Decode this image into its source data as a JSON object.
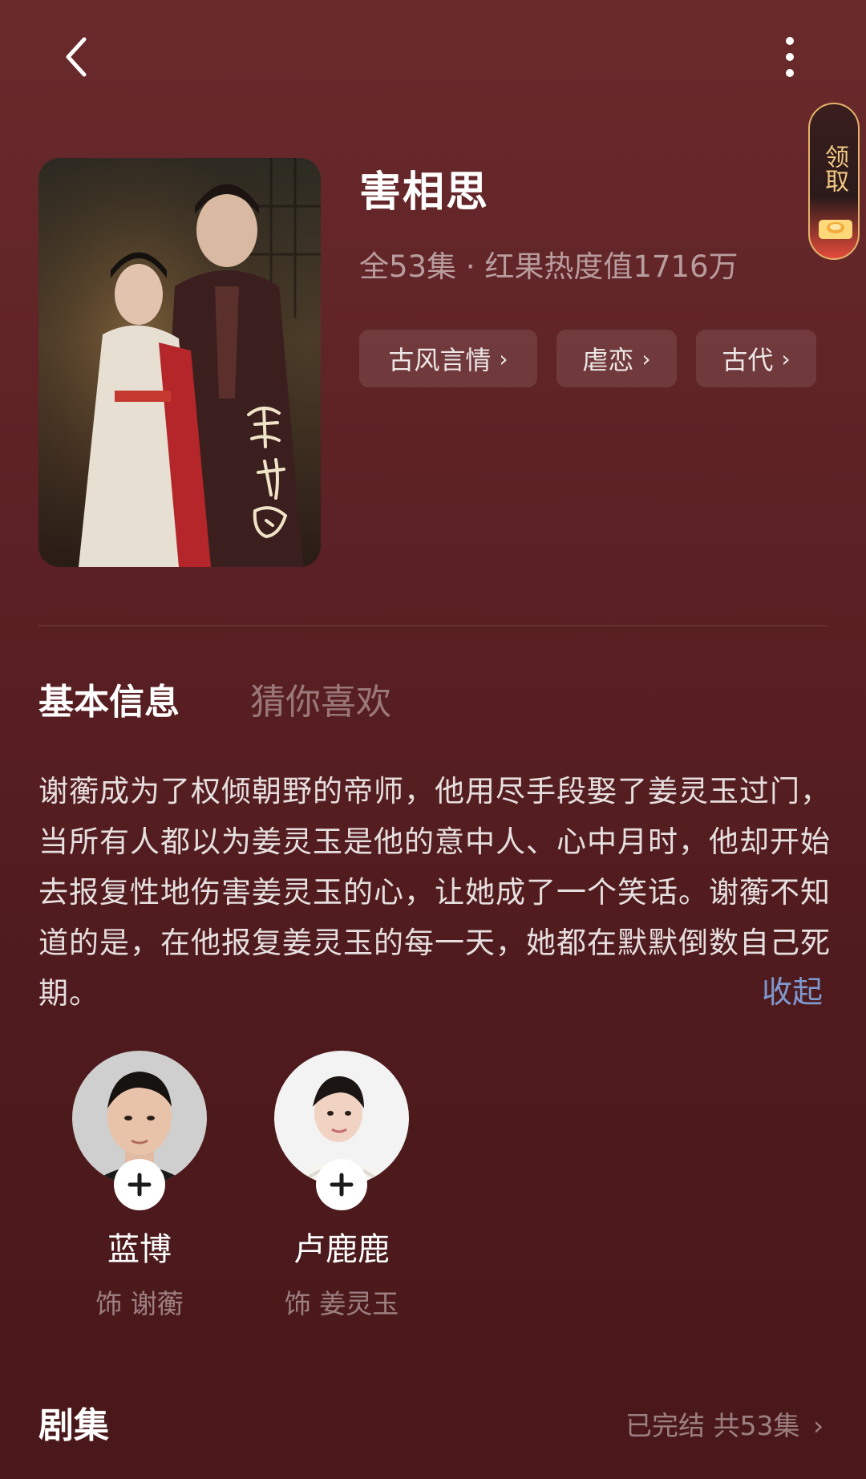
{
  "reward": {
    "label": "领取"
  },
  "drama": {
    "title": "害相思",
    "meta": "全53集 · 红果热度值1716万",
    "tags": [
      {
        "label": "古风言情"
      },
      {
        "label": "虐恋"
      },
      {
        "label": "古代"
      }
    ]
  },
  "tabs": [
    {
      "label": "基本信息",
      "active": true
    },
    {
      "label": "猜你喜欢",
      "active": false
    }
  ],
  "description": {
    "text": "谢蘅成为了权倾朝野的帝师，他用尽手段娶了姜灵玉过门，当所有人都以为姜灵玉是他的意中人、心中月时，他却开始去报复性地伤害姜灵玉的心，让她成了一个笑话。谢蘅不知道的是，在他报复姜灵玉的每一天，她都在默默倒数自己死期。",
    "collapse_label": "收起"
  },
  "cast": [
    {
      "name": "蓝博",
      "role": "饰 谢蘅"
    },
    {
      "name": "卢鹿鹿",
      "role": "饰 姜灵玉"
    }
  ],
  "episodes": {
    "title": "剧集",
    "status": "已完结 共53集"
  },
  "colors": {
    "background_top": "#6a2a2c",
    "background_bottom": "#4a181a",
    "accent_link": "#7e9ad0",
    "reward_gold": "#f1c985"
  },
  "icons": {
    "back": "chevron-left-icon",
    "more": "more-vertical-icon",
    "tag_chevron": "chevron-right-icon",
    "follow": "plus-icon",
    "coin": "coin-icon"
  }
}
